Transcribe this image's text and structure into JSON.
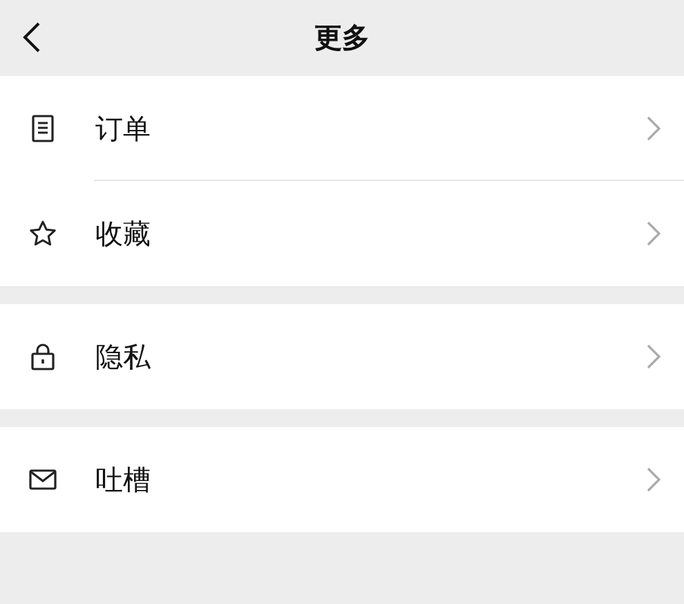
{
  "header": {
    "title": "更多"
  },
  "sections": [
    {
      "items": [
        {
          "kind": "document",
          "label": "订单"
        },
        {
          "kind": "star",
          "label": "收藏"
        }
      ]
    },
    {
      "items": [
        {
          "kind": "lock",
          "label": "隐私"
        }
      ]
    },
    {
      "items": [
        {
          "kind": "mail",
          "label": "吐槽"
        }
      ]
    }
  ]
}
